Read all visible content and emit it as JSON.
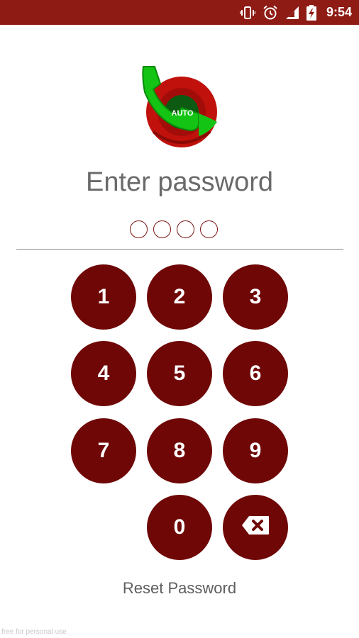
{
  "status_bar": {
    "time": "9:54",
    "icons": [
      "vibrate-icon",
      "alarm-icon",
      "signal-icon",
      "battery-charging-icon"
    ],
    "background_color": "#8e1b14"
  },
  "logo": {
    "badge_text": "AUTO",
    "icon": "phone-auto-logo-icon"
  },
  "title": "Enter password",
  "pin": {
    "length": 4,
    "entered": 0
  },
  "keypad": {
    "keys": [
      "1",
      "2",
      "3",
      "4",
      "5",
      "6",
      "7",
      "8",
      "9",
      "0"
    ],
    "backspace_icon": "backspace-icon",
    "key_color": "#6f0707"
  },
  "reset_label": "Reset Password",
  "watermark": "free for personal use"
}
